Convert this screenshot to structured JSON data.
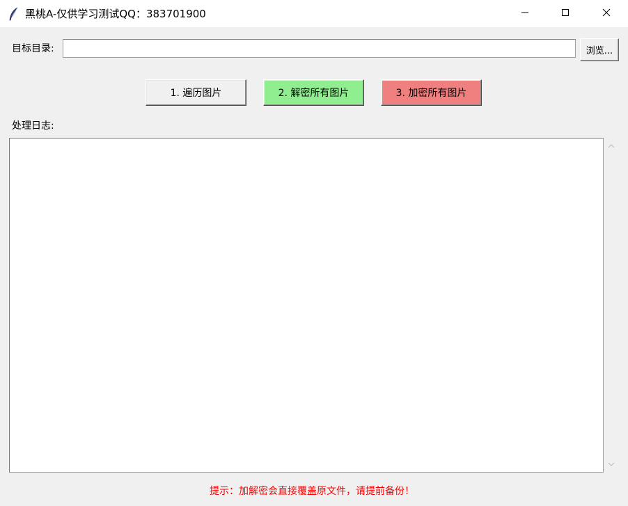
{
  "window": {
    "title": "黑桃A-仅供学习测试QQ：383701900",
    "icon": "feather-icon"
  },
  "controls": {
    "minimize": "minimize-icon",
    "maximize": "maximize-icon",
    "close": "close-icon"
  },
  "directory": {
    "label": "目标目录:",
    "value": "",
    "browse_label": "浏览..."
  },
  "actions": {
    "scan_label": "1. 遍历图片",
    "decrypt_label": "2. 解密所有图片",
    "encrypt_label": "3. 加密所有图片"
  },
  "colors": {
    "decrypt": "#90ee90",
    "encrypt": "#f08080",
    "hint": "#ff0000"
  },
  "log": {
    "label": "处理日志:",
    "content": ""
  },
  "hint": {
    "text": "提示：加解密会直接覆盖原文件，请提前备份！"
  }
}
